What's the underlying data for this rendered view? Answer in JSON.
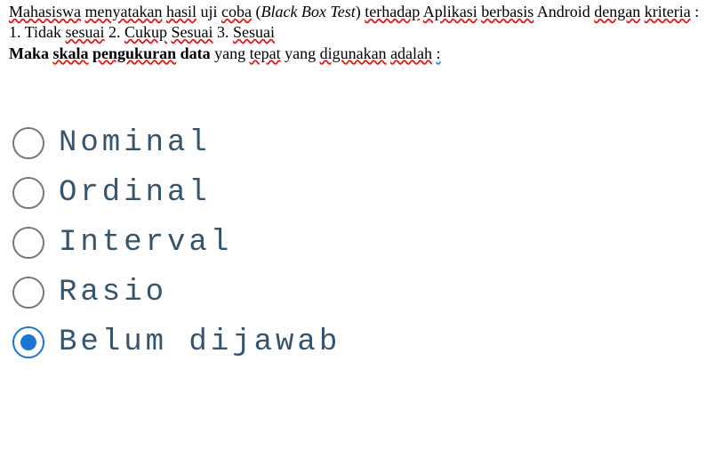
{
  "question": {
    "segments": [
      {
        "text": "Mahasiswa",
        "cls": "wavy-r"
      },
      {
        "text": " ",
        "cls": ""
      },
      {
        "text": "menyatakan",
        "cls": "wavy-r"
      },
      {
        "text": " ",
        "cls": ""
      },
      {
        "text": "hasil",
        "cls": "wavy-r"
      },
      {
        "text": " uji ",
        "cls": ""
      },
      {
        "text": "coba",
        "cls": "wavy-r"
      },
      {
        "text": " (",
        "cls": ""
      },
      {
        "text": "Black Box Test",
        "cls": "italic"
      },
      {
        "text": ") ",
        "cls": ""
      },
      {
        "text": "terhadap",
        "cls": "wavy-r"
      },
      {
        "text": " ",
        "cls": ""
      },
      {
        "text": "Aplikasi",
        "cls": "wavy-r"
      },
      {
        "text": "  ",
        "cls": ""
      },
      {
        "text": "berbasis",
        "cls": "wavy-r"
      },
      {
        "text": " Android  ",
        "cls": ""
      },
      {
        "text": "dengan",
        "cls": "wavy-r"
      },
      {
        "text": " ",
        "cls": ""
      },
      {
        "text": "kriteria",
        "cls": "wavy-r"
      },
      {
        "text": " : 1. Tidak ",
        "cls": ""
      },
      {
        "text": "sesuai",
        "cls": "wavy-r"
      },
      {
        "text": "          2. ",
        "cls": ""
      },
      {
        "text": "Cukup",
        "cls": "wavy-r"
      },
      {
        "text": " ",
        "cls": ""
      },
      {
        "text": "Sesuai",
        "cls": "wavy-r"
      },
      {
        "text": "            3. ",
        "cls": ""
      },
      {
        "text": "Sesuai",
        "cls": "wavy-r"
      }
    ],
    "line3_segments": [
      {
        "text": "Maka ",
        "cls": "bold"
      },
      {
        "text": "skala",
        "cls": "bold wavy-r"
      },
      {
        "text": " ",
        "cls": "bold"
      },
      {
        "text": "pengukuran",
        "cls": "bold wavy-r"
      },
      {
        "text": " data ",
        "cls": "bold"
      },
      {
        "text": "yang ",
        "cls": ""
      },
      {
        "text": "tepat",
        "cls": "wavy-r"
      },
      {
        "text": " yang ",
        "cls": ""
      },
      {
        "text": "digunakan",
        "cls": "wavy-r"
      },
      {
        "text": " ",
        "cls": ""
      },
      {
        "text": "adalah",
        "cls": "wavy-r"
      },
      {
        "text": " ",
        "cls": ""
      },
      {
        "text": ":",
        "cls": "wavy-b2"
      }
    ]
  },
  "options": [
    {
      "id": "opt-nominal",
      "label": "Nominal",
      "selected": false
    },
    {
      "id": "opt-ordinal",
      "label": "Ordinal",
      "selected": false
    },
    {
      "id": "opt-interval",
      "label": "Interval",
      "selected": false
    },
    {
      "id": "opt-rasio",
      "label": "Rasio",
      "selected": false
    },
    {
      "id": "opt-belum",
      "label": "Belum dijawab",
      "selected": true
    }
  ]
}
